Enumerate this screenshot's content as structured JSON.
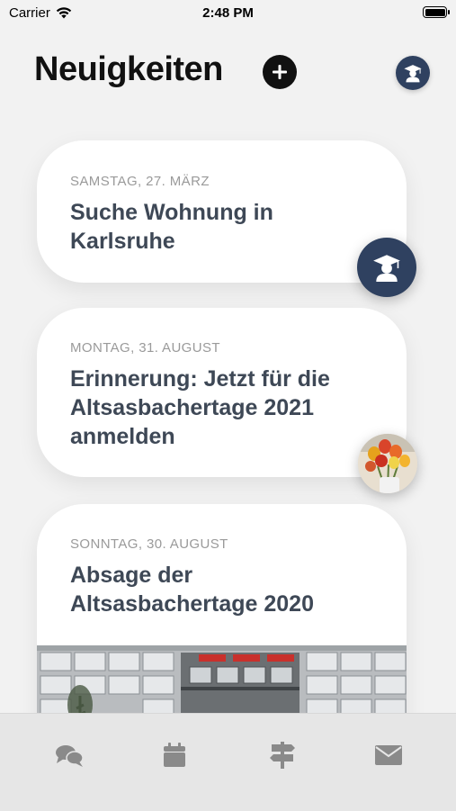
{
  "status_bar": {
    "carrier": "Carrier",
    "time": "2:48 PM"
  },
  "header": {
    "title": "Neuigkeiten"
  },
  "news": [
    {
      "date": "SAMSTAG, 27. MÄRZ",
      "title": "Suche Wohnung in Karlsruhe",
      "author_icon": "graduate-icon"
    },
    {
      "date": "MONTAG, 31. AUGUST",
      "title": "Erinnerung: Jetzt für die Altsasbachertage 2021 anmelden",
      "author_icon": "tulip-photo"
    },
    {
      "date": "SONNTAG, 30. AUGUST",
      "title": "Absage der Altsasbachertage 2020",
      "image": "school-building-photo"
    }
  ],
  "tabs": [
    {
      "icon": "chat-bubbles-icon"
    },
    {
      "icon": "calendar-icon"
    },
    {
      "icon": "signpost-icon"
    },
    {
      "icon": "mail-icon"
    }
  ],
  "colors": {
    "accent": "#2f4160",
    "text": "#3e4856",
    "date": "#9a9a9a",
    "background": "#f2f2f2",
    "tab_icon": "#8a8a8a"
  }
}
